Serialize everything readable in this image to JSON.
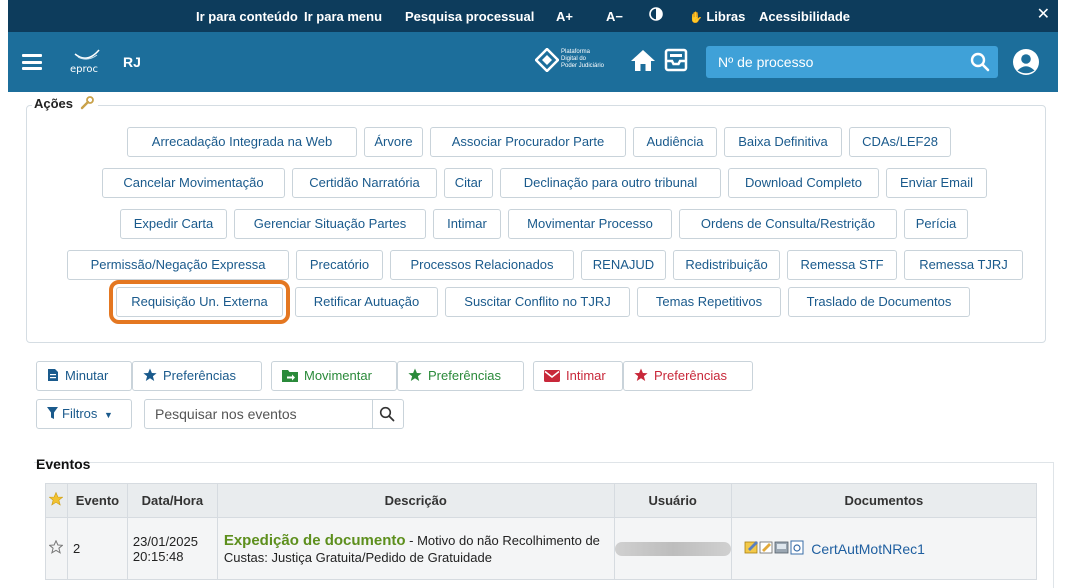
{
  "topbar": {
    "links": [
      "Ir para conteúdo",
      "Ir para menu",
      "Pesquisa processual",
      "A+",
      "A−",
      "Libras",
      "Acessibilidade"
    ],
    "close": "✕"
  },
  "header": {
    "app": "eproc",
    "state": "RJ",
    "pdpj_lines": [
      "Plataforma",
      "Digital do",
      "Poder Judiciário"
    ],
    "search_placeholder": "Nº de processo"
  },
  "acoes": {
    "legend": "Ações",
    "rows": [
      [
        "Arrecadação Integrada na Web",
        "Árvore",
        "Associar Procurador Parte",
        "Audiência",
        "Baixa Definitiva",
        "CDAs/LEF28"
      ],
      [
        "Cancelar Movimentação",
        "Certidão Narratória",
        "Citar",
        "Declinação para outro tribunal",
        "Download Completo",
        "Enviar Email"
      ],
      [
        "Expedir Carta",
        "Gerenciar Situação Partes",
        "Intimar",
        "Movimentar Processo",
        "Ordens de Consulta/Restrição",
        "Perícia"
      ],
      [
        "Permissão/Negação Expressa",
        "Precatório",
        "Processos Relacionados",
        "RENAJUD",
        "Redistribuição",
        "Remessa STF",
        "Remessa TJRJ"
      ],
      [
        "Requisição Un. Externa",
        "Retificar Autuação",
        "Suscitar Conflito no TJRJ",
        "Temas Repetitivos",
        "Traslado de Documentos"
      ]
    ],
    "highlighted": "Requisição Un. Externa"
  },
  "toolbar": {
    "minutar": "Minutar",
    "pref1": "Preferências",
    "movimentar": "Movimentar",
    "pref2": "Preferências",
    "intimar": "Intimar",
    "pref3": "Preferências",
    "filtros": "Filtros",
    "search_placeholder": "Pesquisar nos eventos"
  },
  "eventos": {
    "title": "Eventos",
    "columns": [
      "Evento",
      "Data/Hora",
      "Descrição",
      "Usuário",
      "Documentos"
    ],
    "rows": [
      {
        "evento": "2",
        "data": "23/01/2025",
        "hora": "20:15:48",
        "titulo": "Expedição de documento",
        "descricao": " - Motivo do não Recolhimento de Custas: Justiça Gratuita/Pedido de Gratuidade",
        "documento": "CertAutMotNRec1"
      }
    ]
  },
  "colors": {
    "topbar": "#0d3c5c",
    "header": "#1c6e9b",
    "search": "#3fa1d8",
    "highlight": "#e47721",
    "link": "#1a5a8c"
  }
}
